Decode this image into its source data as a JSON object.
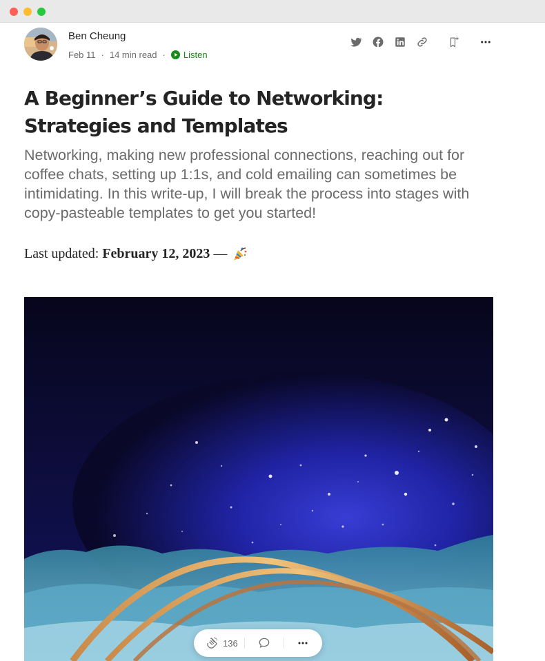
{
  "post": {
    "author": "Ben Cheung",
    "date": "Feb 11",
    "read_time": "14 min read",
    "separator": "·",
    "listen_label": "Listen",
    "title": "A Beginner’s Guide to Networking: Strategies and Templates",
    "subtitle": "Networking, making new professional connections, reaching out for coffee chats, setting up 1:1s, and cold emailing can sometimes be intimidating. In this write-up, I will break the process into stages with copy-pasteable templates to get you started!",
    "updated_label": "Last updated:",
    "updated_date": "February 12, 2023",
    "updated_dash": "—"
  },
  "actions": {
    "icons": [
      "twitter-icon",
      "facebook-icon",
      "linkedin-icon",
      "link-icon",
      "bookmark-add-icon",
      "more-icon"
    ]
  },
  "floating_bar": {
    "clap_count": "136",
    "icons": [
      "clap-icon",
      "comment-icon",
      "more-icon"
    ]
  },
  "colors": {
    "accent_green": "#1a8917",
    "text": "#242424",
    "muted": "#6b6b6b"
  }
}
